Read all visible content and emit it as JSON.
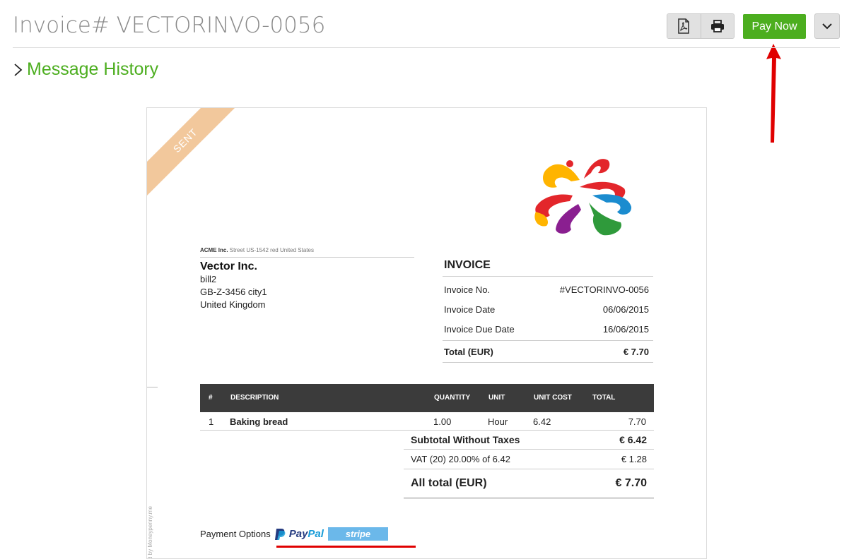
{
  "header": {
    "title": "Invoice# VECTORINVO-0056",
    "pay_now_label": "Pay Now"
  },
  "message_history": {
    "label": "Message History"
  },
  "invoice": {
    "ribbon": "SENT",
    "sender": {
      "company": "ACME Inc.",
      "address": "Street US-1542 red United States"
    },
    "bill_to": {
      "name": "Vector Inc.",
      "lines": [
        "bill2",
        "GB-Z-3456 city1",
        "United Kingdom"
      ]
    },
    "summary": {
      "heading": "INVOICE",
      "rows": [
        {
          "label": "Invoice No.",
          "value": "#VECTORINVO-0056"
        },
        {
          "label": "Invoice Date",
          "value": "06/06/2015"
        },
        {
          "label": "Invoice Due Date",
          "value": "16/06/2015"
        }
      ],
      "total_label": "Total (EUR)",
      "total_value": "€ 7.70"
    },
    "items_table": {
      "columns": [
        "#",
        "DESCRIPTION",
        "QUANTITY",
        "UNIT",
        "UNIT COST",
        "TOTAL"
      ],
      "rows": [
        {
          "num": "1",
          "description": "Baking bread",
          "quantity": "1.00",
          "unit": "Hour",
          "unit_cost": "6.42",
          "total": "7.70"
        }
      ]
    },
    "totals": {
      "subtotal_label": "Subtotal Without Taxes",
      "subtotal_value": "€ 6.42",
      "vat_label": "VAT (20) 20.00% of 6.42",
      "vat_value": "€ 1.28",
      "all_label": "All total (EUR)",
      "all_value": "€ 7.70"
    },
    "payment": {
      "label": "Payment Options",
      "paypal_pay": "Pay",
      "paypal_pal": "Pal",
      "stripe": "stripe"
    },
    "watermark": "d by Moneypenny.me"
  },
  "colors": {
    "accent_green": "#4cae1f",
    "ribbon": "#f2c89c",
    "table_header": "#3b3b3b",
    "annotation_red": "#e00000"
  }
}
